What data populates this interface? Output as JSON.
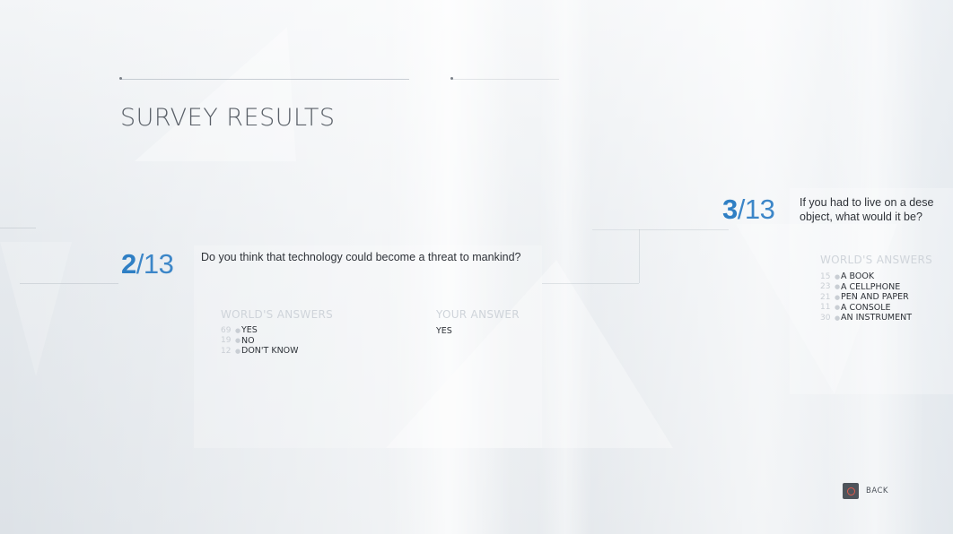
{
  "screen": {
    "title": "SURVEY RESULTS"
  },
  "questions": [
    {
      "current": "2",
      "separator": "/",
      "total": "13",
      "text": "Do you think that technology could become a threat to mankind?",
      "worlds_answers_label": "WORLD'S ANSWERS",
      "your_answer_label": "YOUR ANSWER",
      "your_answer": "YES",
      "answers": [
        {
          "percent": "69",
          "label": "YES"
        },
        {
          "percent": "19",
          "label": "NO"
        },
        {
          "percent": "12",
          "label": "DON'T KNOW"
        }
      ]
    },
    {
      "current": "3",
      "separator": "/",
      "total": "13",
      "text_line1": "If you had to live on a dese",
      "text_line2": "object, what would it be?",
      "worlds_answers_label": "WORLD'S ANSWERS",
      "answers": [
        {
          "percent": "15",
          "label": "A BOOK"
        },
        {
          "percent": "23",
          "label": "A CELLPHONE"
        },
        {
          "percent": "21",
          "label": "PEN AND PAPER"
        },
        {
          "percent": "11",
          "label": "A CONSOLE"
        },
        {
          "percent": "30",
          "label": "AN INSTRUMENT"
        }
      ]
    }
  ],
  "footer": {
    "back_label": "BACK",
    "back_icon": "circle-button-icon"
  },
  "colors": {
    "accent_blue": "#2f7fc4",
    "text_dark": "#2e3238",
    "muted": "#cfd4da",
    "circle_icon": "#e05a4d"
  }
}
